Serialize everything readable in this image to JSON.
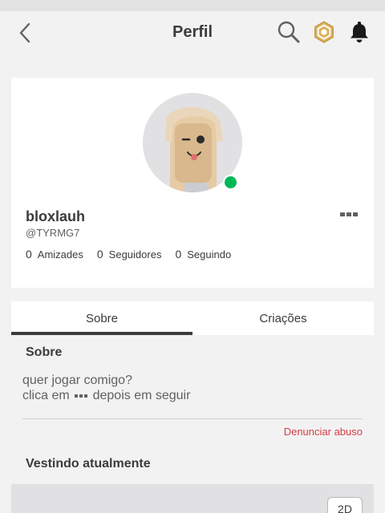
{
  "header": {
    "title": "Perfil",
    "icons": [
      "chevron-left-icon",
      "search-icon",
      "robux-icon",
      "bell-icon"
    ]
  },
  "profile": {
    "display_name": "bloxlauh",
    "username": "@TYRMG7",
    "online_status_color": "#02b757",
    "stats": [
      {
        "count": "0",
        "label": "Amizades"
      },
      {
        "count": "0",
        "label": "Seguidores"
      },
      {
        "count": "0",
        "label": "Seguindo"
      }
    ]
  },
  "tabs": [
    {
      "label": "Sobre",
      "active": true
    },
    {
      "label": "Criações",
      "active": false
    }
  ],
  "about": {
    "heading": "Sobre",
    "line1": "quer jogar comigo?",
    "line2_before": "clica em",
    "line2_after": "depois em seguir",
    "report_label": "Denunciar abuso"
  },
  "wearing": {
    "heading": "Vestindo atualmente",
    "toggle_label": "2D"
  },
  "colors": {
    "background": "#f2f2f3",
    "card": "#ffffff",
    "text": "#393b3d",
    "report": "#d63f45",
    "robux_gold": "#d9b15a"
  }
}
